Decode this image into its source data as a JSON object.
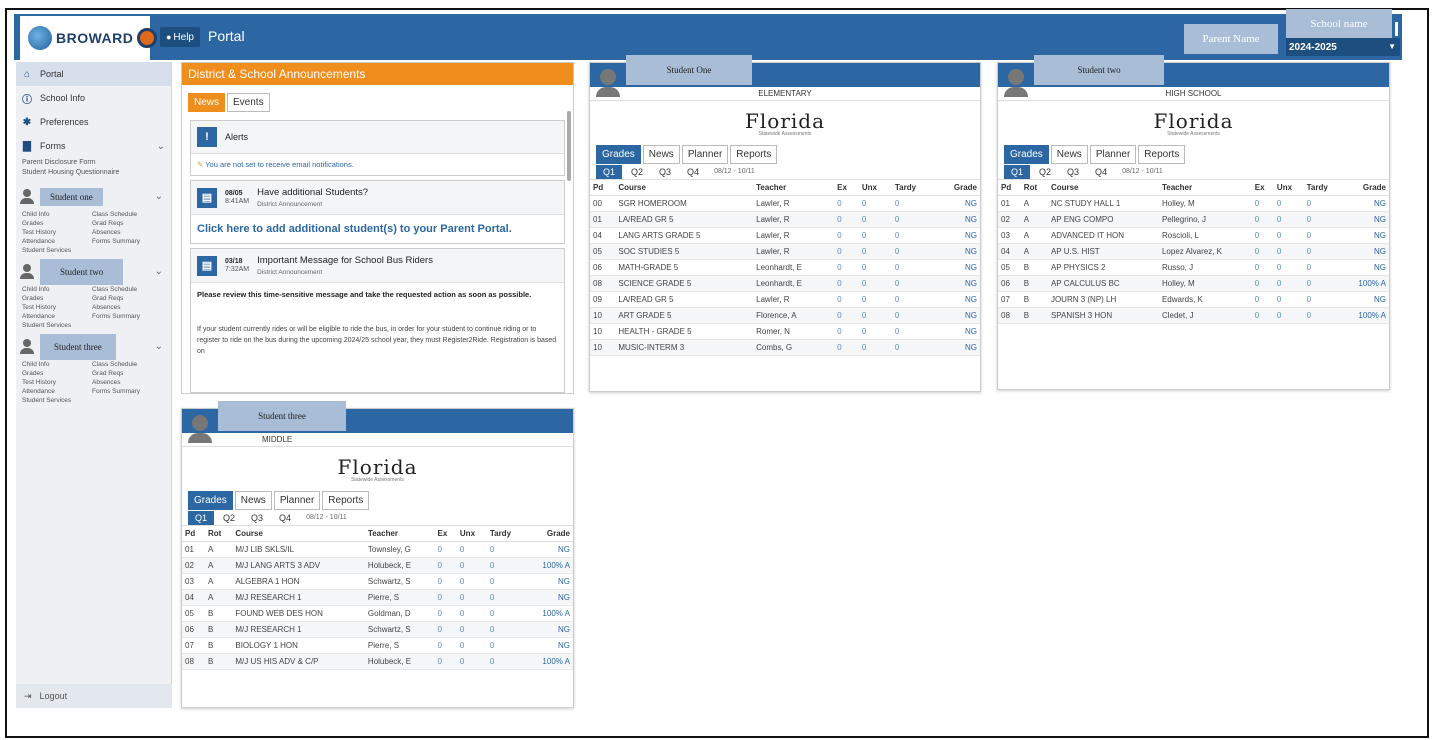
{
  "header": {
    "logo_text": "BROWARD",
    "help_label": "Help",
    "portal_title": "Portal",
    "parent_name": "Parent Name",
    "school_name": "School name",
    "year": "2024-2025"
  },
  "sidebar": {
    "nav": [
      {
        "label": "Portal",
        "icon": "home-icon"
      },
      {
        "label": "School Info",
        "icon": "info-icon"
      },
      {
        "label": "Preferences",
        "icon": "gear-icon"
      },
      {
        "label": "Forms",
        "icon": "document-icon"
      }
    ],
    "forms_links": [
      "Parent Disclosure Form",
      "Student Housing Questionnaire"
    ],
    "students": [
      {
        "name": "Student one",
        "links": [
          "Child Info",
          "Class Schedule",
          "Grades",
          "Grad Reqs",
          "Test History",
          "Absences",
          "Attendance",
          "Forms Summary",
          "Student Services"
        ]
      },
      {
        "name": "Student two",
        "links": [
          "Child Info",
          "Class Schedule",
          "Grades",
          "Grad Reqs",
          "Test History",
          "Absences",
          "Attendance",
          "Forms Summary",
          "Student Services"
        ]
      },
      {
        "name": "Student three",
        "links": [
          "Child Info",
          "Class Schedule",
          "Grades",
          "Grad Reqs",
          "Test History",
          "Absences",
          "Attendance",
          "Forms Summary",
          "Student Services"
        ]
      }
    ],
    "logout": "Logout"
  },
  "announcements": {
    "title": "District & School Announcements",
    "tabs": [
      "News",
      "Events"
    ],
    "alerts_title": "Alerts",
    "alerts_body": "You are not set to receive email notifications.",
    "item1": {
      "date": "08/05",
      "time": "8:41AM",
      "title": "Have additional Students?",
      "sub": "District Announcement",
      "link": "Click here to add additional student(s) to your Parent Portal."
    },
    "item2": {
      "date": "03/18",
      "time": "7:32AM",
      "title": "Important Message for School Bus Riders",
      "sub": "District Announcement",
      "body1": "Please review this time-sensitive message and take the requested action as soon as possible.",
      "body2": "If your student currently rides or will be eligible to ride the bus, in order for your student to continue riding or to register to ride on the bus during the upcoming 2024/25 school year, they must Register2Ride. Registration is based on"
    }
  },
  "panel_common": {
    "florida": "Florida",
    "florida_sub": "Statewide Assessments",
    "tabs": [
      "Grades",
      "News",
      "Planner",
      "Reports"
    ],
    "quarters": [
      "Q1",
      "Q2",
      "Q3",
      "Q4"
    ],
    "date_range": "08/12 - 10/11",
    "cols": {
      "pd": "Pd",
      "rot": "Rot",
      "course": "Course",
      "teacher": "Teacher",
      "ex": "Ex",
      "unx": "Unx",
      "tardy": "Tardy",
      "grade": "Grade"
    }
  },
  "student_one": {
    "name": "Student One",
    "school": "ELEMENTARY",
    "rows": [
      [
        "00",
        "SGR HOMEROOM",
        "Lawler, R",
        "0",
        "0",
        "0",
        "NG"
      ],
      [
        "01",
        "LA/READ GR 5",
        "Lawler, R",
        "0",
        "0",
        "0",
        "NG"
      ],
      [
        "04",
        "LANG ARTS GRADE 5",
        "Lawler, R",
        "0",
        "0",
        "0",
        "NG"
      ],
      [
        "05",
        "SOC STUDIES 5",
        "Lawler, R",
        "0",
        "0",
        "0",
        "NG"
      ],
      [
        "06",
        "MATH-GRADE 5",
        "Leonhardt, E",
        "0",
        "0",
        "0",
        "NG"
      ],
      [
        "08",
        "SCIENCE GRADE 5",
        "Leonhardt, E",
        "0",
        "0",
        "0",
        "NG"
      ],
      [
        "09",
        "LA/READ GR 5",
        "Lawler, R",
        "0",
        "0",
        "0",
        "NG"
      ],
      [
        "10",
        "ART GRADE 5",
        "Florence, A",
        "0",
        "0",
        "0",
        "NG"
      ],
      [
        "10",
        "HEALTH - GRADE 5",
        "Romer, N",
        "0",
        "0",
        "0",
        "NG"
      ],
      [
        "10",
        "MUSIC-INTERM 3",
        "Combs, G",
        "0",
        "0",
        "0",
        "NG"
      ]
    ]
  },
  "student_two": {
    "name": "Student two",
    "school": "HIGH SCHOOL",
    "rows": [
      [
        "01",
        "A",
        "NC STUDY HALL 1",
        "Holley, M",
        "0",
        "0",
        "0",
        "NG"
      ],
      [
        "02",
        "A",
        "AP ENG COMPO",
        "Pellegrino, J",
        "0",
        "0",
        "0",
        "NG"
      ],
      [
        "03",
        "A",
        "ADVANCED IT HON",
        "Roscioli, L",
        "0",
        "0",
        "0",
        "NG"
      ],
      [
        "04",
        "A",
        "AP U.S. HIST",
        "Lopez Alvarez, K",
        "0",
        "0",
        "0",
        "NG"
      ],
      [
        "05",
        "B",
        "AP PHYSICS 2",
        "Russo, J",
        "0",
        "0",
        "0",
        "NG"
      ],
      [
        "06",
        "B",
        "AP CALCULUS BC",
        "Holley, M",
        "0",
        "0",
        "0",
        "100% A"
      ],
      [
        "07",
        "B",
        "JOURN 3 (NP) LH",
        "Edwards, K",
        "0",
        "0",
        "0",
        "NG"
      ],
      [
        "08",
        "B",
        "SPANISH 3 HON",
        "Cledet, J",
        "0",
        "0",
        "0",
        "100% A"
      ]
    ]
  },
  "student_three": {
    "name": "Student three",
    "school": "MIDDLE",
    "rows": [
      [
        "01",
        "A",
        "M/J LIB SKLS/IL",
        "Townsley, G",
        "0",
        "0",
        "0",
        "NG"
      ],
      [
        "02",
        "A",
        "M/J LANG ARTS 3 ADV",
        "Holubeck, E",
        "0",
        "0",
        "0",
        "100% A"
      ],
      [
        "03",
        "A",
        "ALGEBRA 1 HON",
        "Schwartz, S",
        "0",
        "0",
        "0",
        "NG"
      ],
      [
        "04",
        "A",
        "M/J RESEARCH 1",
        "Pierre, S",
        "0",
        "0",
        "0",
        "NG"
      ],
      [
        "05",
        "B",
        "FOUND WEB DES HON",
        "Goldman, D",
        "0",
        "0",
        "0",
        "100% A"
      ],
      [
        "06",
        "B",
        "M/J RESEARCH 1",
        "Schwartz, S",
        "0",
        "0",
        "0",
        "NG"
      ],
      [
        "07",
        "B",
        "BIOLOGY 1 HON",
        "Pierre, S",
        "0",
        "0",
        "0",
        "NG"
      ],
      [
        "08",
        "B",
        "M/J US HIS ADV & C/P",
        "Holubeck, E",
        "0",
        "0",
        "0",
        "100% A"
      ]
    ]
  }
}
